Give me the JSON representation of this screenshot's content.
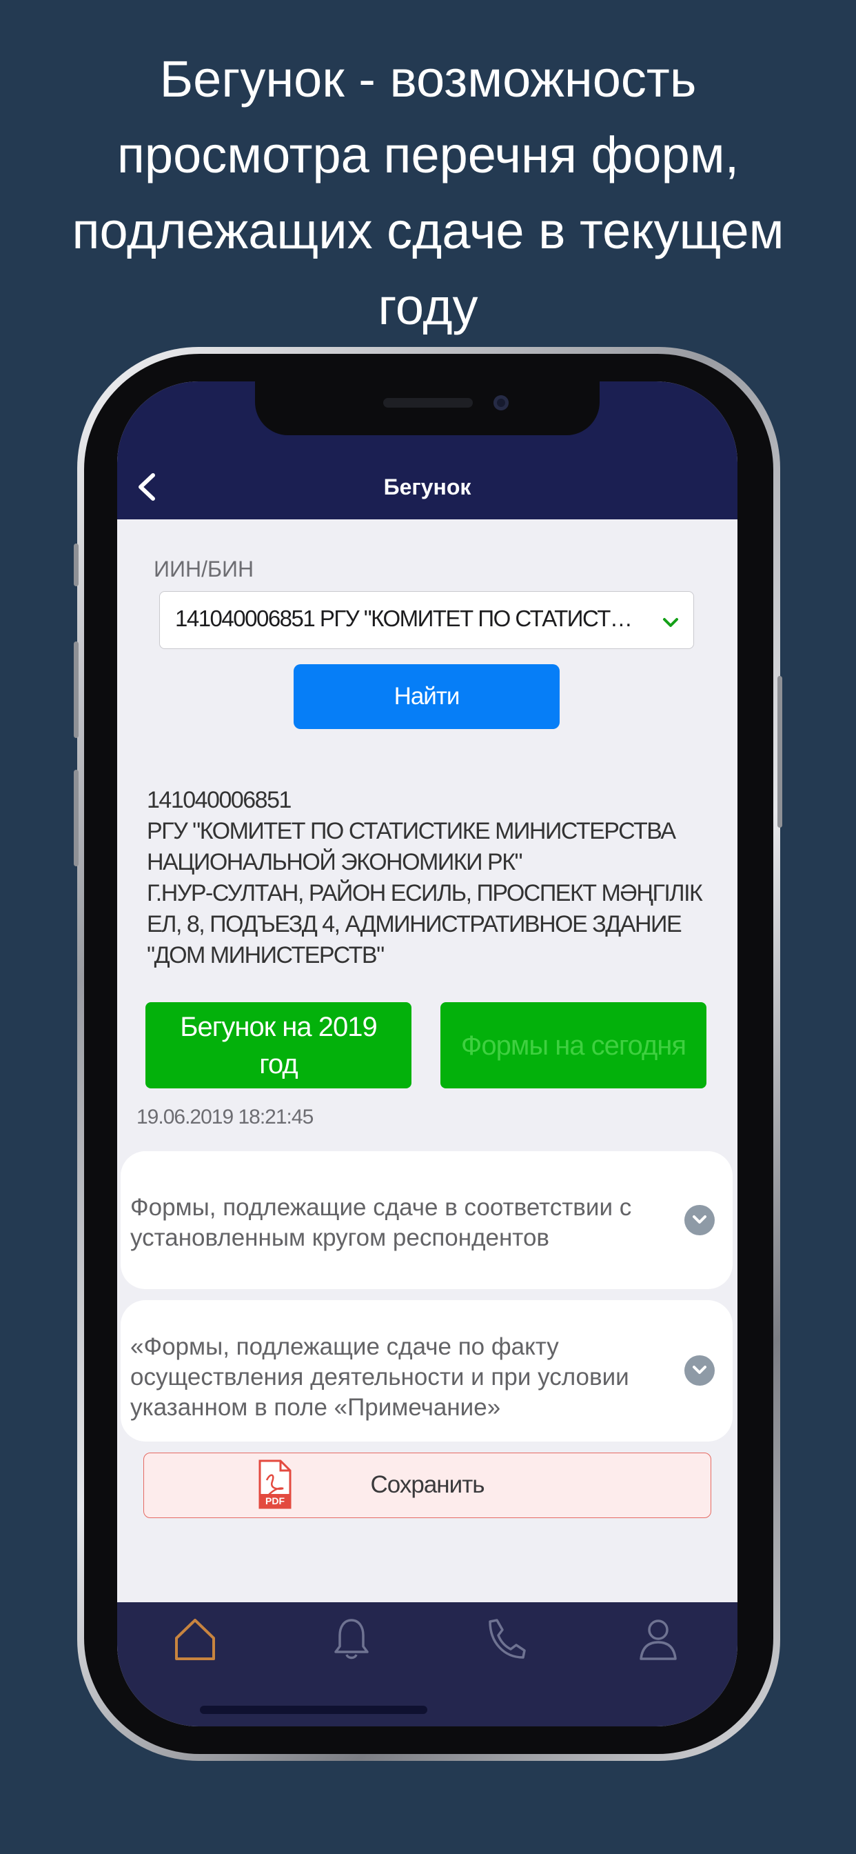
{
  "headline": {
    "line1": "Бегунок - возможность",
    "line2": "просмотра перечня форм,",
    "line3": "подлежащих сдаче в текущем",
    "line4": "году"
  },
  "colors": {
    "page_background": "#243a52",
    "nav_background": "#1b1f52",
    "primary_button": "#067ef7",
    "green_button": "#03b10b",
    "tabbar_active": "#c8843f"
  },
  "nav": {
    "title": "Бегунок",
    "back_icon": "chevron-left-icon"
  },
  "search": {
    "label": "ИИН/БИН",
    "selected_value": "141040006851 РГУ \"КОМИТЕТ ПО СТАТИСТИКЕ...",
    "find_button": "Найти"
  },
  "organization": {
    "bin": "141040006851",
    "name": "РГУ \"КОМИТЕТ ПО СТАТИСТИКЕ МИНИСТЕРСТВА НАЦИОНАЛЬНОЙ ЭКОНОМИКИ РК\"",
    "address": "Г.НУР-СУЛТАН, РАЙОН ЕСИЛЬ, ПРОСПЕКТ МӘҢГІЛІК ЕЛ, 8, ПОДЪЕЗД 4, АДМИНИСТРАТИВНОЕ ЗДАНИЕ \"ДОМ МИНИСТЕРСТВ\""
  },
  "actions": {
    "runner_year": "Бегунок на 2019 год",
    "forms_today": "Формы на сегодня"
  },
  "timestamp": "19.06.2019 18:21:45",
  "sections": [
    {
      "title": "Формы, подлежащие сдаче в соответствии с установленным кругом респондентов"
    },
    {
      "title": "«Формы, подлежащие сдаче по факту осуществления деятельности и при условии указанном в поле «Примечание»"
    }
  ],
  "save": {
    "label": "Сохранить",
    "icon": "pdf-icon",
    "icon_text": "PDF"
  },
  "tabbar": {
    "items": [
      {
        "icon": "home-icon",
        "active": true
      },
      {
        "icon": "bell-icon",
        "active": false
      },
      {
        "icon": "phone-icon",
        "active": false
      },
      {
        "icon": "profile-icon",
        "active": false
      }
    ]
  }
}
